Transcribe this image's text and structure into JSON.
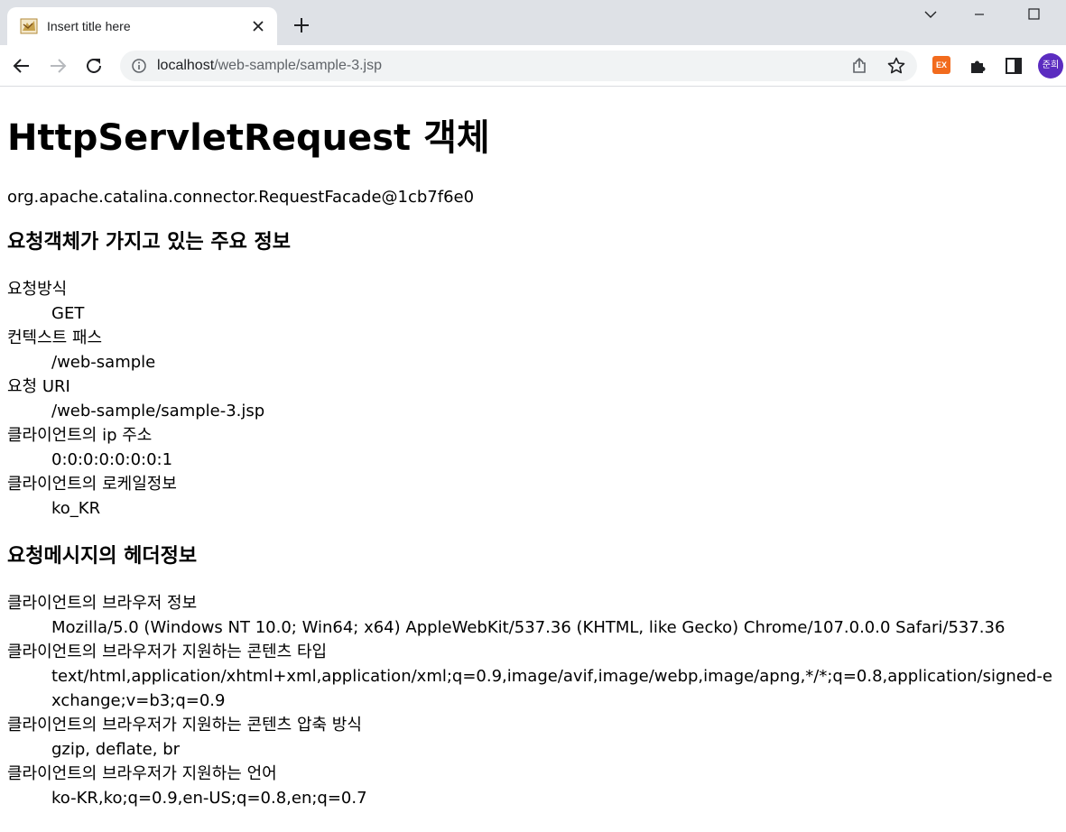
{
  "browser": {
    "tab_title": "Insert title here",
    "url_host": "localhost",
    "url_path": "/web-sample/sample-3.jsp",
    "extension_badge": "EX",
    "profile_initials": "준희"
  },
  "page": {
    "heading": "HttpServletRequest 객체",
    "request_object": "org.apache.catalina.connector.RequestFacade@1cb7f6e0",
    "section_main": {
      "title": "요청객체가 가지고 있는 주요 정보",
      "items": [
        {
          "term": "요청방식",
          "value": "GET"
        },
        {
          "term": "컨텍스트 패스",
          "value": "/web-sample"
        },
        {
          "term": "요청 URI",
          "value": "/web-sample/sample-3.jsp"
        },
        {
          "term": "클라이언트의 ip 주소",
          "value": "0:0:0:0:0:0:0:1"
        },
        {
          "term": "클라이언트의 로케일정보",
          "value": "ko_KR"
        }
      ]
    },
    "section_headers": {
      "title": "요청메시지의 헤더정보",
      "items": [
        {
          "term": "클라이언트의 브라우저 정보",
          "value": "Mozilla/5.0 (Windows NT 10.0; Win64; x64) AppleWebKit/537.36 (KHTML, like Gecko) Chrome/107.0.0.0 Safari/537.36"
        },
        {
          "term": "클라이언트의 브라우저가 지원하는 콘텐츠 타입",
          "value": "text/html,application/xhtml+xml,application/xml;q=0.9,image/avif,image/webp,image/apng,*/*;q=0.8,application/signed-exchange;v=b3;q=0.9"
        },
        {
          "term": "클라이언트의 브라우저가 지원하는 콘텐츠 압축 방식",
          "value": "gzip, deflate, br"
        },
        {
          "term": "클라이언트의 브라우저가 지원하는 언어",
          "value": "ko-KR,ko;q=0.9,en-US;q=0.8,en;q=0.7"
        }
      ]
    }
  }
}
